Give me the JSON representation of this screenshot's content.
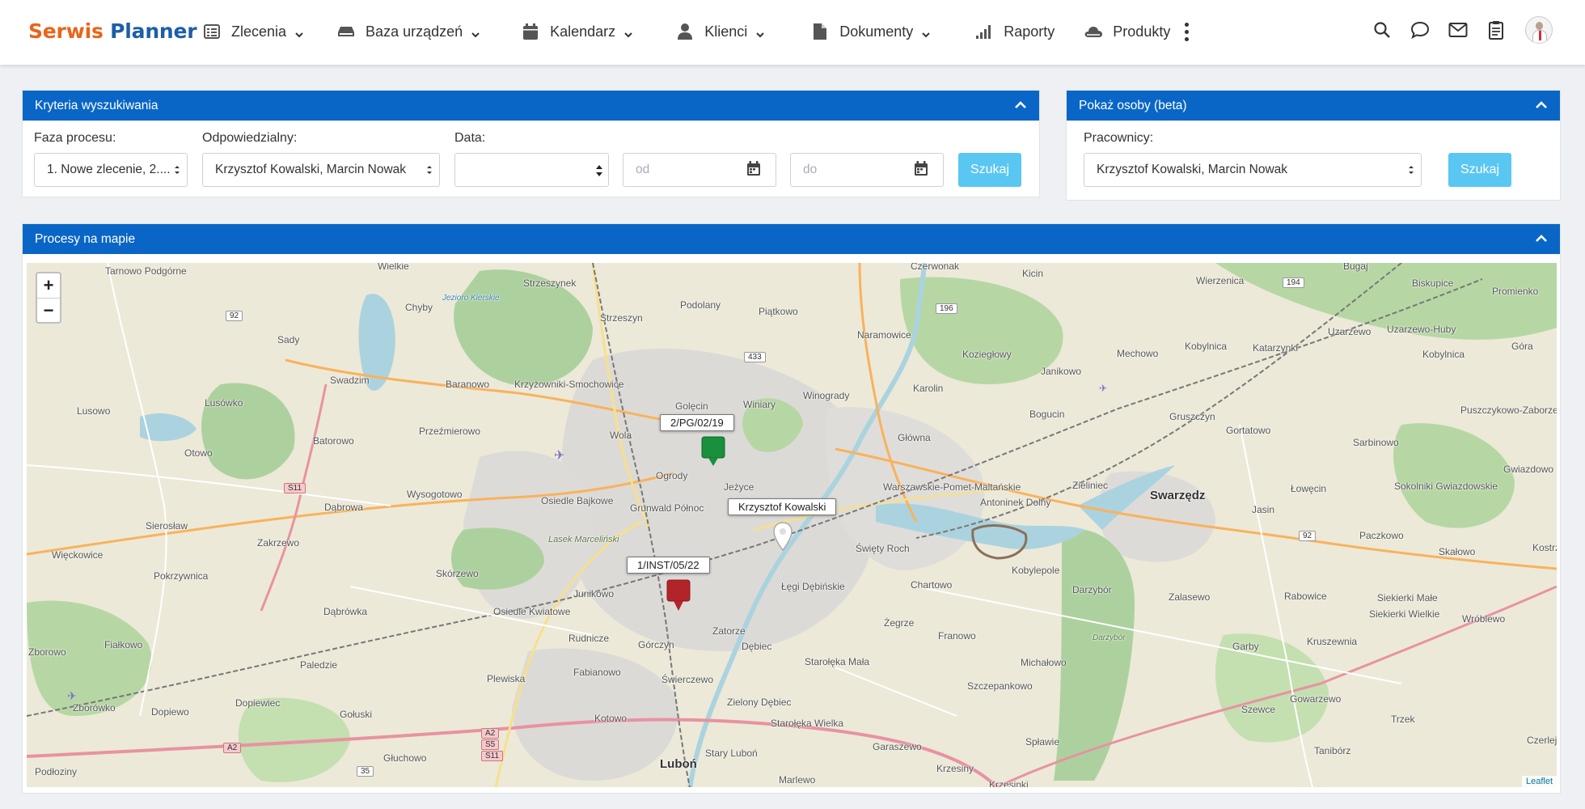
{
  "brand": {
    "part1": "Serwis",
    "part2": "Planner"
  },
  "nav": {
    "items": [
      {
        "label": "Zlecenia",
        "icon": "list-icon",
        "dropdown": true
      },
      {
        "label": "Baza urządzeń",
        "icon": "device-icon",
        "dropdown": true
      },
      {
        "label": "Kalendarz",
        "icon": "calendar-icon",
        "dropdown": true
      },
      {
        "label": "Klienci",
        "icon": "user-icon",
        "dropdown": true
      },
      {
        "label": "Dokumenty",
        "icon": "document-icon",
        "dropdown": true
      },
      {
        "label": "Raporty",
        "icon": "signal-bars-icon",
        "dropdown": false
      },
      {
        "label": "Produkty",
        "icon": "cloud-icon",
        "dropdown": false
      }
    ]
  },
  "search_panel": {
    "title": "Kryteria wyszukiwania",
    "phase_label": "Faza procesu:",
    "phase_value": "1. Nowe zlecenie, 2....",
    "responsible_label": "Odpowiedzialny:",
    "responsible_value": "Krzysztof Kowalski, Marcin Nowak",
    "date_label": "Data:",
    "date_value": "",
    "from_placeholder": "od",
    "to_placeholder": "do",
    "search_button": "Szukaj"
  },
  "people_panel": {
    "title": "Pokaż osoby (beta)",
    "workers_label": "Pracownicy:",
    "workers_value": "Krzysztof Kowalski, Marcin Nowak",
    "search_button": "Szukaj"
  },
  "map_panel": {
    "title": "Procesy na mapie",
    "zoom_in": "+",
    "zoom_out": "−",
    "attribution": "Leaflet",
    "markers": [
      {
        "label": "2/PG/02/19",
        "color": "#1a8f3c"
      },
      {
        "label": "Krzysztof Kowalski",
        "color": "#ffffff"
      },
      {
        "label": "1/INST/05/22",
        "color": "#b3242a"
      }
    ],
    "places": {
      "p01": "Tarnowo Podgórne",
      "p02": "Wielkie",
      "p03": "Strzeszynek",
      "p04": "Podolany",
      "p05": "Piątkowo",
      "p06": "Czerwonak",
      "p07": "Kicin",
      "p08": "Wierzenica",
      "p09": "Bugaj",
      "p10": "Biskupice",
      "p11": "Promienko",
      "p12": "Chyby",
      "p13": "Jezioro Kierskie",
      "p14": "Strzeszyn",
      "p15": "Naramowice",
      "p16": "Sady",
      "p17": "Koziegłowy",
      "p18": "Mechowo",
      "p19": "Kobylnica",
      "p20": "Uzarzewo",
      "p21": "Uzarzewo-Huby",
      "p22": "Góra",
      "p23": "Swadzim",
      "p24": "Baranowo",
      "p25": "Krzyżowniki-Smochowice",
      "p26": "Golęcin",
      "p27": "Winiary",
      "p28": "Winogrady",
      "p29": "Karolin",
      "p30": "Janikowo",
      "p31": "Katarzynki",
      "p32": "Kobylnica",
      "p33": "Lusowo",
      "p34": "Lusówko",
      "p35": "Batorowo",
      "p36": "Przeźmierowo",
      "p37": "Bogucin",
      "p38": "Gruszczyn",
      "p39": "Puszczykowo-Zaborze",
      "p40": "Otowo",
      "p41": "Wola",
      "p42": "Główna",
      "p43": "Gortatowo",
      "p44": "Sarbinowo",
      "p45": "Gwiazdowo",
      "p46": "Ogrody",
      "p47": "Wysogotowo",
      "p48": "Osiedle Bajkowe",
      "p49": "Jeżyce",
      "p50": "Warszawskie-Pomet-Maltańskie",
      "p51": "Antoninek Dolny",
      "p52": "Zieliniec",
      "p53": "Swarzędz",
      "p54": "Jasin",
      "p55": "Łowęcin",
      "p56": "Sokolniki Gwiazdowskie",
      "p57": "Grunwald Północ",
      "p58": "Sierosław",
      "p59": "Dąbrowa",
      "p60": "Zakrzewo",
      "p61": "Lasek Marceliński",
      "p62": "Święty Roch",
      "p63": "Paczkowo",
      "p64": "Skałowo",
      "p65": "Kostrzyn",
      "p66": "Więckowice",
      "p67": "Pokrzywnica",
      "p68": "Skórzewo",
      "p69": "Junikowo",
      "p70": "Łęgi Dębińskie",
      "p71": "Chartowo",
      "p72": "Kobylepole",
      "p73": "Darzybór",
      "p74": "Zalasewo",
      "p75": "Rabowice",
      "p76": "Siekierki Małe",
      "p77": "Siekierki Wielkie",
      "p78": "Dąbrówka",
      "p79": "Osiedle Kwiatowe",
      "p80": "Rudnicze",
      "p81": "Górczyn",
      "p82": "Zatorze",
      "p83": "Żegrze",
      "p84": "Franowo",
      "p85": "Garby",
      "p86": "Kruszewnia",
      "p87": "Wróblewo",
      "p88": "Fiałkowo",
      "p89": "Zborowo",
      "p90": "Dębiec",
      "p91": "Starołęka Mała",
      "p92": "Michałowo",
      "p93": "Paledzie",
      "p94": "Fabianowo",
      "p95": "Świerczewo",
      "p96": "Plewiska",
      "p97": "Szczepankowo",
      "p98": "Gowarzewo",
      "p99": "Zborówko",
      "p100": "Dopiewiec",
      "p101": "Dopiewo",
      "p102": "Gołuski",
      "p103": "Kotowo",
      "p104": "Zielony Dębiec",
      "p105": "Starołęka Wielka",
      "p106": "Szewce",
      "p107": "Trzek",
      "p108": "Czerlejno",
      "p109": "Głuchowo",
      "p110": "Luboń",
      "p111": "Stary Luboń",
      "p112": "Garaszewo",
      "p113": "Spławie",
      "p114": "Tanibórz",
      "p115": "Podłoziny",
      "p116": "Marlewo",
      "p117": "Krzesiny",
      "p118": "Krzesinki",
      "p119": "Czerlejn",
      "p120": "Darzybór",
      "p121": "Kost"
    },
    "roads": {
      "r1": "92",
      "r2": "433",
      "r3": "196",
      "r4": "194",
      "r5": "S11",
      "r6": "92",
      "r7": "A2",
      "r8": "A2",
      "r9": "S5",
      "r10": "S11",
      "r11": "35"
    }
  }
}
